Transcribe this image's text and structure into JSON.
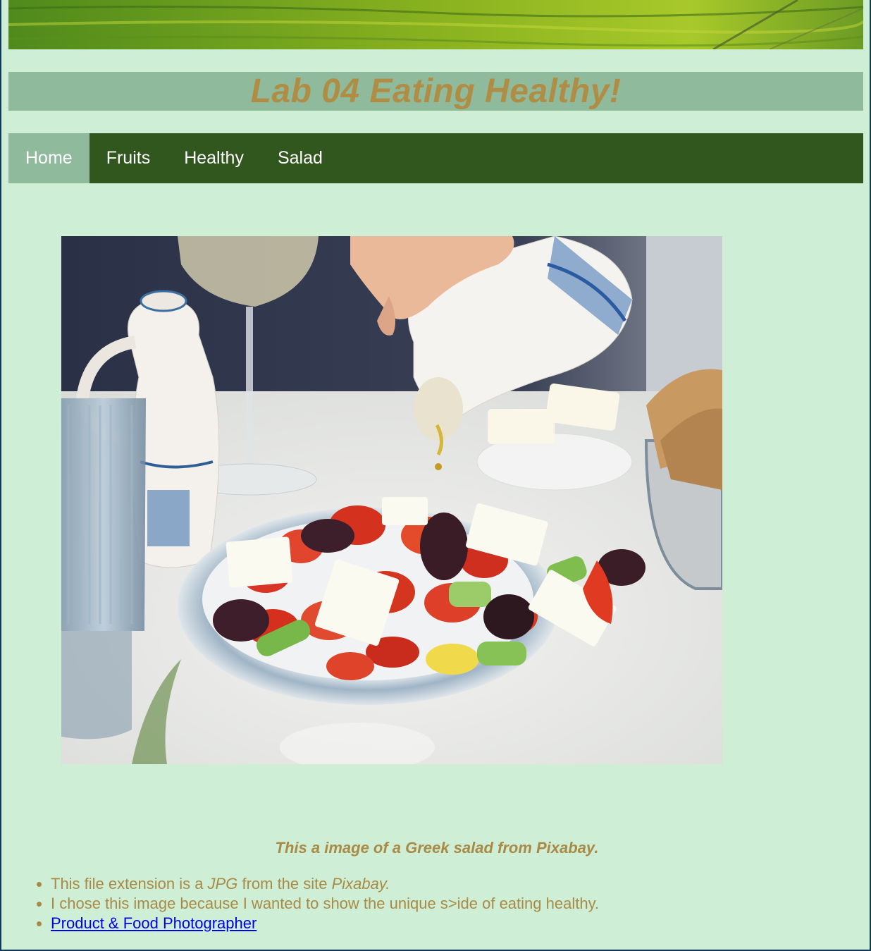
{
  "header": {
    "banner_image": "green-fields-banner",
    "title": "Lab 04 Eating Healthy!"
  },
  "nav": {
    "items": [
      {
        "label": "Home",
        "active": true
      },
      {
        "label": "Fruits",
        "active": false
      },
      {
        "label": "Healthy",
        "active": false
      },
      {
        "label": "Salad",
        "active": false
      }
    ]
  },
  "main": {
    "image": "greek-salad-photo",
    "caption": "This a image of a Greek salad from Pixabay.",
    "facts": {
      "item1_pre": "This file extension is a ",
      "item1_ext": "JPG",
      "item1_mid": " from the site ",
      "item1_site": "Pixabay.",
      "item2": "I chose this image because I wanted to show the unique s>ide of eating healthy.",
      "link_label": "Product & Food Photographer"
    }
  },
  "colors": {
    "page_bg": "#cfeed6",
    "title_bg": "#8fba9b",
    "title_text": "#b08d44",
    "nav_bg": "#31561e",
    "nav_active_bg": "#8fba9b",
    "body_text": "#a98a45",
    "link": "#0000ee"
  }
}
